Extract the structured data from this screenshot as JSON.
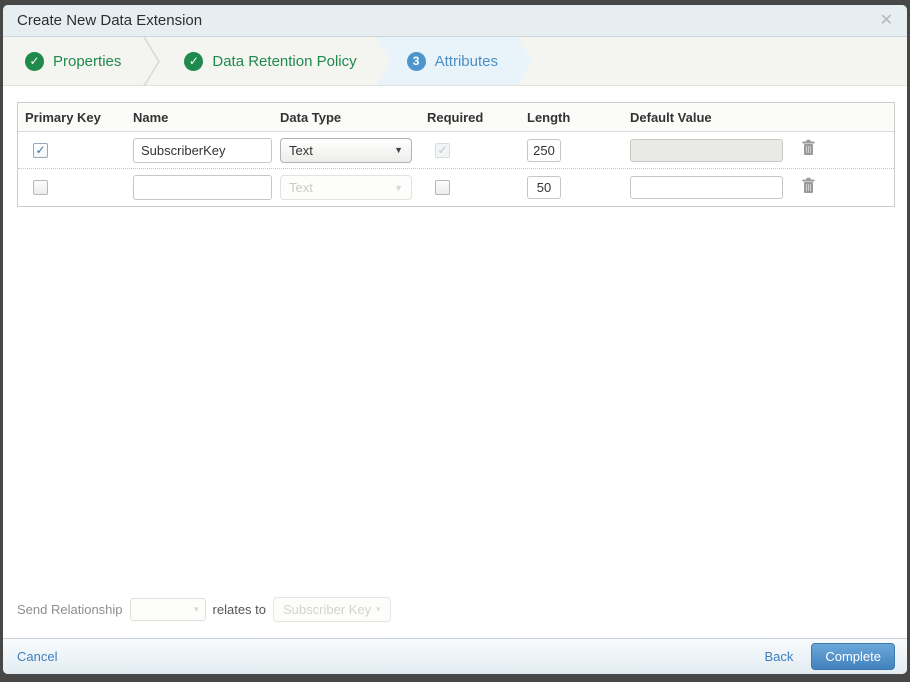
{
  "modal": {
    "title": "Create New Data Extension",
    "close_glyph": "✕"
  },
  "steps": [
    {
      "label": "Properties",
      "status": "complete",
      "badge_glyph": "✓"
    },
    {
      "label": "Data Retention Policy",
      "status": "complete",
      "badge_glyph": "✓"
    },
    {
      "label": "Attributes",
      "status": "active",
      "badge_number": "3"
    }
  ],
  "table": {
    "headers": [
      "Primary Key",
      "Name",
      "Data Type",
      "Required",
      "Length",
      "Default Value"
    ],
    "rows": [
      {
        "primary_key_checked": true,
        "name": "SubscriberKey",
        "data_type": "Text",
        "required_checked": true,
        "required_disabled": true,
        "length": "250",
        "default_value": "",
        "default_disabled": true
      },
      {
        "primary_key_checked": false,
        "name": "",
        "data_type": "Text",
        "data_type_disabled": true,
        "required_checked": false,
        "length": "50",
        "default_value": "",
        "default_disabled": false
      }
    ],
    "check_glyph": "✓",
    "caret_glyph": "▼"
  },
  "send_relationship": {
    "label": "Send Relationship",
    "relates_label": "relates to",
    "target_value": "Subscriber Key",
    "caret_glyph": "▾"
  },
  "footer": {
    "cancel_label": "Cancel",
    "back_label": "Back",
    "complete_label": "Complete"
  },
  "colors": {
    "accent_blue": "#4a90c6",
    "success_green": "#1f8a4c",
    "titlebar_bg": "#e7eef2",
    "active_step_bg": "#e9f3fa",
    "button_blue": "#4282bd"
  }
}
